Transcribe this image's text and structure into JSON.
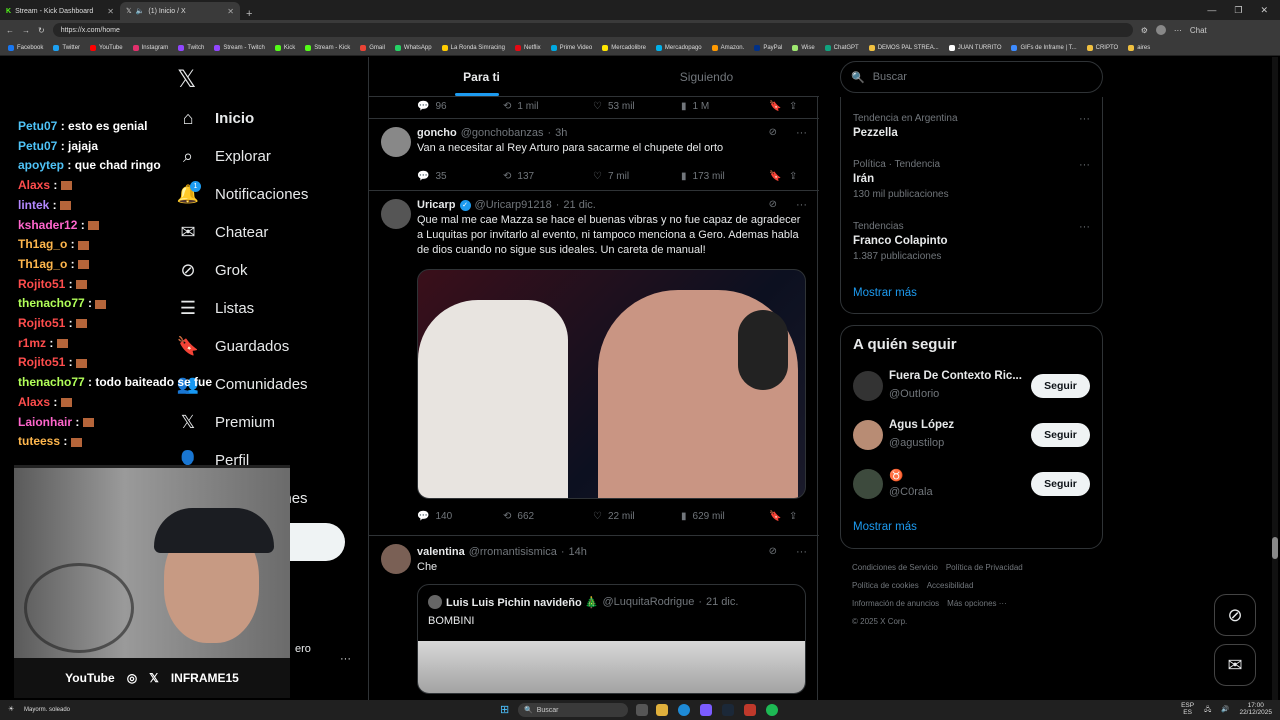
{
  "browser": {
    "tabs": [
      {
        "label": "Stream - Kick Dashboard"
      },
      {
        "label": "(1) Inicio / X"
      }
    ],
    "new_tab": "+",
    "url": "https://x.com/home",
    "bookmarks": [
      "Facebook",
      "Twitter",
      "YouTube",
      "Instagram",
      "Twitch",
      "Stream - Twitch",
      "Kick",
      "Stream - Kick",
      "Gmail",
      "WhatsApp",
      "La Ronda Simracing",
      "Netflix",
      "Prime Video",
      "Mercadolibre",
      "Mercadopago",
      "Amazon.",
      "PayPal",
      "Wise",
      "ChatGPT",
      "DEMOS PAL STREA...",
      "JUAN TURRITO",
      "GIFs de Inframe | T...",
      "CRIPTO",
      "aires"
    ],
    "profile_label": "Chat"
  },
  "stream_chat": [
    {
      "user": "Petu07",
      "color": "#4fc3f7",
      "text": "esto es genial"
    },
    {
      "user": "Petu07",
      "color": "#4fc3f7",
      "text": "jajaja"
    },
    {
      "user": "apoytep",
      "color": "#4fc3f7",
      "text": "que chad ringo"
    },
    {
      "user": "Alaxs",
      "color": "#ff4d4d",
      "text": ""
    },
    {
      "user": "lintek",
      "color": "#b388ff",
      "text": ""
    },
    {
      "user": "kshader12",
      "color": "#ff66cc",
      "text": ""
    },
    {
      "user": "Th1ag_o",
      "color": "#ffb74d",
      "text": ""
    },
    {
      "user": "Th1ag_o",
      "color": "#ffb74d",
      "text": ""
    },
    {
      "user": "Rojito51",
      "color": "#ff4d4d",
      "text": ""
    },
    {
      "user": "thenacho77",
      "color": "#b2ff59",
      "text": ""
    },
    {
      "user": "Rojito51",
      "color": "#ff4d4d",
      "text": ""
    },
    {
      "user": "r1mz",
      "color": "#ff4d4d",
      "text": ""
    },
    {
      "user": "Rojito51",
      "color": "#ff4d4d",
      "text": ""
    },
    {
      "user": "thenacho77",
      "color": "#b2ff59",
      "text": "todo baiteado se fue"
    },
    {
      "user": "Alaxs",
      "color": "#ff4d4d",
      "text": ""
    },
    {
      "user": "Laionhair",
      "color": "#ff66cc",
      "text": ""
    },
    {
      "user": "tuteess",
      "color": "#ffb74d",
      "text": ""
    }
  ],
  "webcam": {
    "socials": [
      "YouTube",
      "◎",
      "𝕏",
      "INFRAME15"
    ]
  },
  "nav": {
    "logo": "𝕏",
    "items": [
      {
        "label": "Inicio",
        "icon": "home-icon"
      },
      {
        "label": "Explorar",
        "icon": "search-icon"
      },
      {
        "label": "Notificaciones",
        "icon": "bell-icon"
      },
      {
        "label": "Chatear",
        "icon": "mail-icon"
      },
      {
        "label": "Grok",
        "icon": "grok-icon"
      },
      {
        "label": "Listas",
        "icon": "list-icon"
      },
      {
        "label": "Guardados",
        "icon": "bookmark-icon"
      },
      {
        "label": "Comunidades",
        "icon": "community-icon"
      },
      {
        "label": "Premium",
        "icon": "x-icon"
      },
      {
        "label": "Perfil",
        "icon": "person-icon"
      },
      {
        "label": "Más opciones",
        "icon": "more-icon"
      }
    ],
    "notif_badge": "1",
    "account_fragment": "ero",
    "account_more": "···"
  },
  "feed": {
    "tabs": [
      "Para ti",
      "Siguiendo"
    ],
    "top_actions": {
      "replies": "96",
      "reposts": "1 mil",
      "likes": "53 mil",
      "views": "1 M"
    },
    "tweets": [
      {
        "name": "goncho",
        "handle": "@gonchobanzas",
        "time": "3h",
        "text": "Van a necesitar al Rey Arturo para sacarme el chupete del orto",
        "replies": "35",
        "reposts": "137",
        "likes": "7 mil",
        "views": "173 mil"
      },
      {
        "name": "Uricarp",
        "handle": "@Uricarp91218",
        "time": "21 dic.",
        "text": "Que mal me cae Mazza se hace el buenas vibras y no fue capaz de agradecer a Luquitas por invitarlo al evento, ni tampoco menciona a Gero. Ademas habla de dios cuando no sigue sus ideales. Un careta de manual!",
        "replies": "140",
        "reposts": "662",
        "likes": "22 mil",
        "views": "629 mil"
      },
      {
        "name": "valentina",
        "handle": "@rromantisismica",
        "time": "14h",
        "text": "Che",
        "quote_name": "Luis Luis Pichin navideño 🎄",
        "quote_handle": "@LuquitaRodrigue",
        "quote_time": "21 dic.",
        "quote_text": "BOMBINI"
      }
    ],
    "separator": "·"
  },
  "sidebar": {
    "search_placeholder": "Buscar",
    "trends": [
      {
        "category": "Tendencia en Argentina",
        "name": "Pezzella",
        "count": ""
      },
      {
        "category": "Política · Tendencia",
        "name": "Irán",
        "count": "130 mil publicaciones"
      },
      {
        "category": "Tendencias",
        "name": "Franco Colapinto",
        "count": "1.387 publicaciones"
      }
    ],
    "show_more": "Mostrar más",
    "who_to_follow_title": "A quién seguir",
    "suggestions": [
      {
        "name": "Fuera De Contexto Ric...",
        "handle": "@OutIorio",
        "button": "Seguir"
      },
      {
        "name": "Agus López",
        "handle": "@agustilop",
        "button": "Seguir"
      },
      {
        "name": "♉",
        "handle": "@C0rala",
        "button": "Seguir"
      }
    ],
    "who_show_more": "Mostrar más",
    "footer": [
      "Condiciones de Servicio",
      "Política de Privacidad",
      "Política de cookies",
      "Accesibilidad",
      "Información de anuncios",
      "Más opciones ···",
      "© 2025 X Corp."
    ]
  },
  "taskbar": {
    "search": "Buscar",
    "weather": "Mayorm. soleado",
    "lang": "ESP",
    "lang2": "ES",
    "time": "17:00",
    "date": "22/12/2025"
  },
  "colors": {
    "accent": "#1d9bf0",
    "bg": "#000000",
    "muted": "#71767b",
    "border": "#2f3336"
  }
}
